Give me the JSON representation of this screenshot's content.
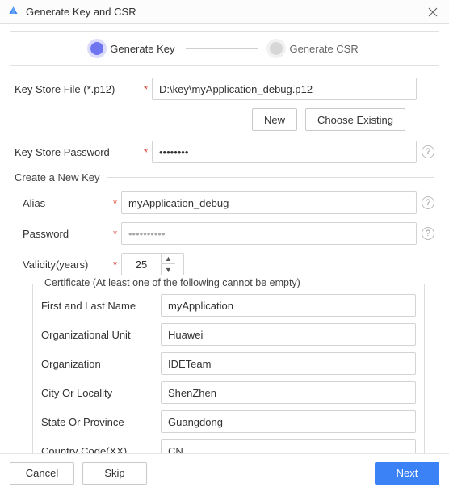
{
  "window": {
    "title": "Generate Key and CSR"
  },
  "stepper": {
    "step1": "Generate Key",
    "step2": "Generate CSR"
  },
  "labels": {
    "keystore_file": "Key Store File (*.p12)",
    "keystore_password": "Key Store Password",
    "section_new_key": "Create a New Key",
    "alias": "Alias",
    "password": "Password",
    "validity": "Validity(years)",
    "cert_legend": "Certificate (At least one of the following cannot be empty)",
    "first_last_name": "First and Last Name",
    "org_unit": "Organizational Unit",
    "organization": "Organization",
    "city": "City Or Locality",
    "state": "State Or Province",
    "country": "Country Code(XX)"
  },
  "buttons": {
    "new": "New",
    "choose_existing": "Choose Existing",
    "cancel": "Cancel",
    "skip": "Skip",
    "next": "Next"
  },
  "values": {
    "keystore_file": "D:\\key\\myApplication_debug.p12",
    "keystore_password": "••••••••",
    "alias": "myApplication_debug",
    "password_placeholder": "••••••••••",
    "validity": "25",
    "first_last_name": "myApplication",
    "org_unit": "Huawei",
    "organization": "IDETeam",
    "city": "ShenZhen",
    "state": "Guangdong",
    "country": "CN"
  },
  "help_glyph": "?"
}
